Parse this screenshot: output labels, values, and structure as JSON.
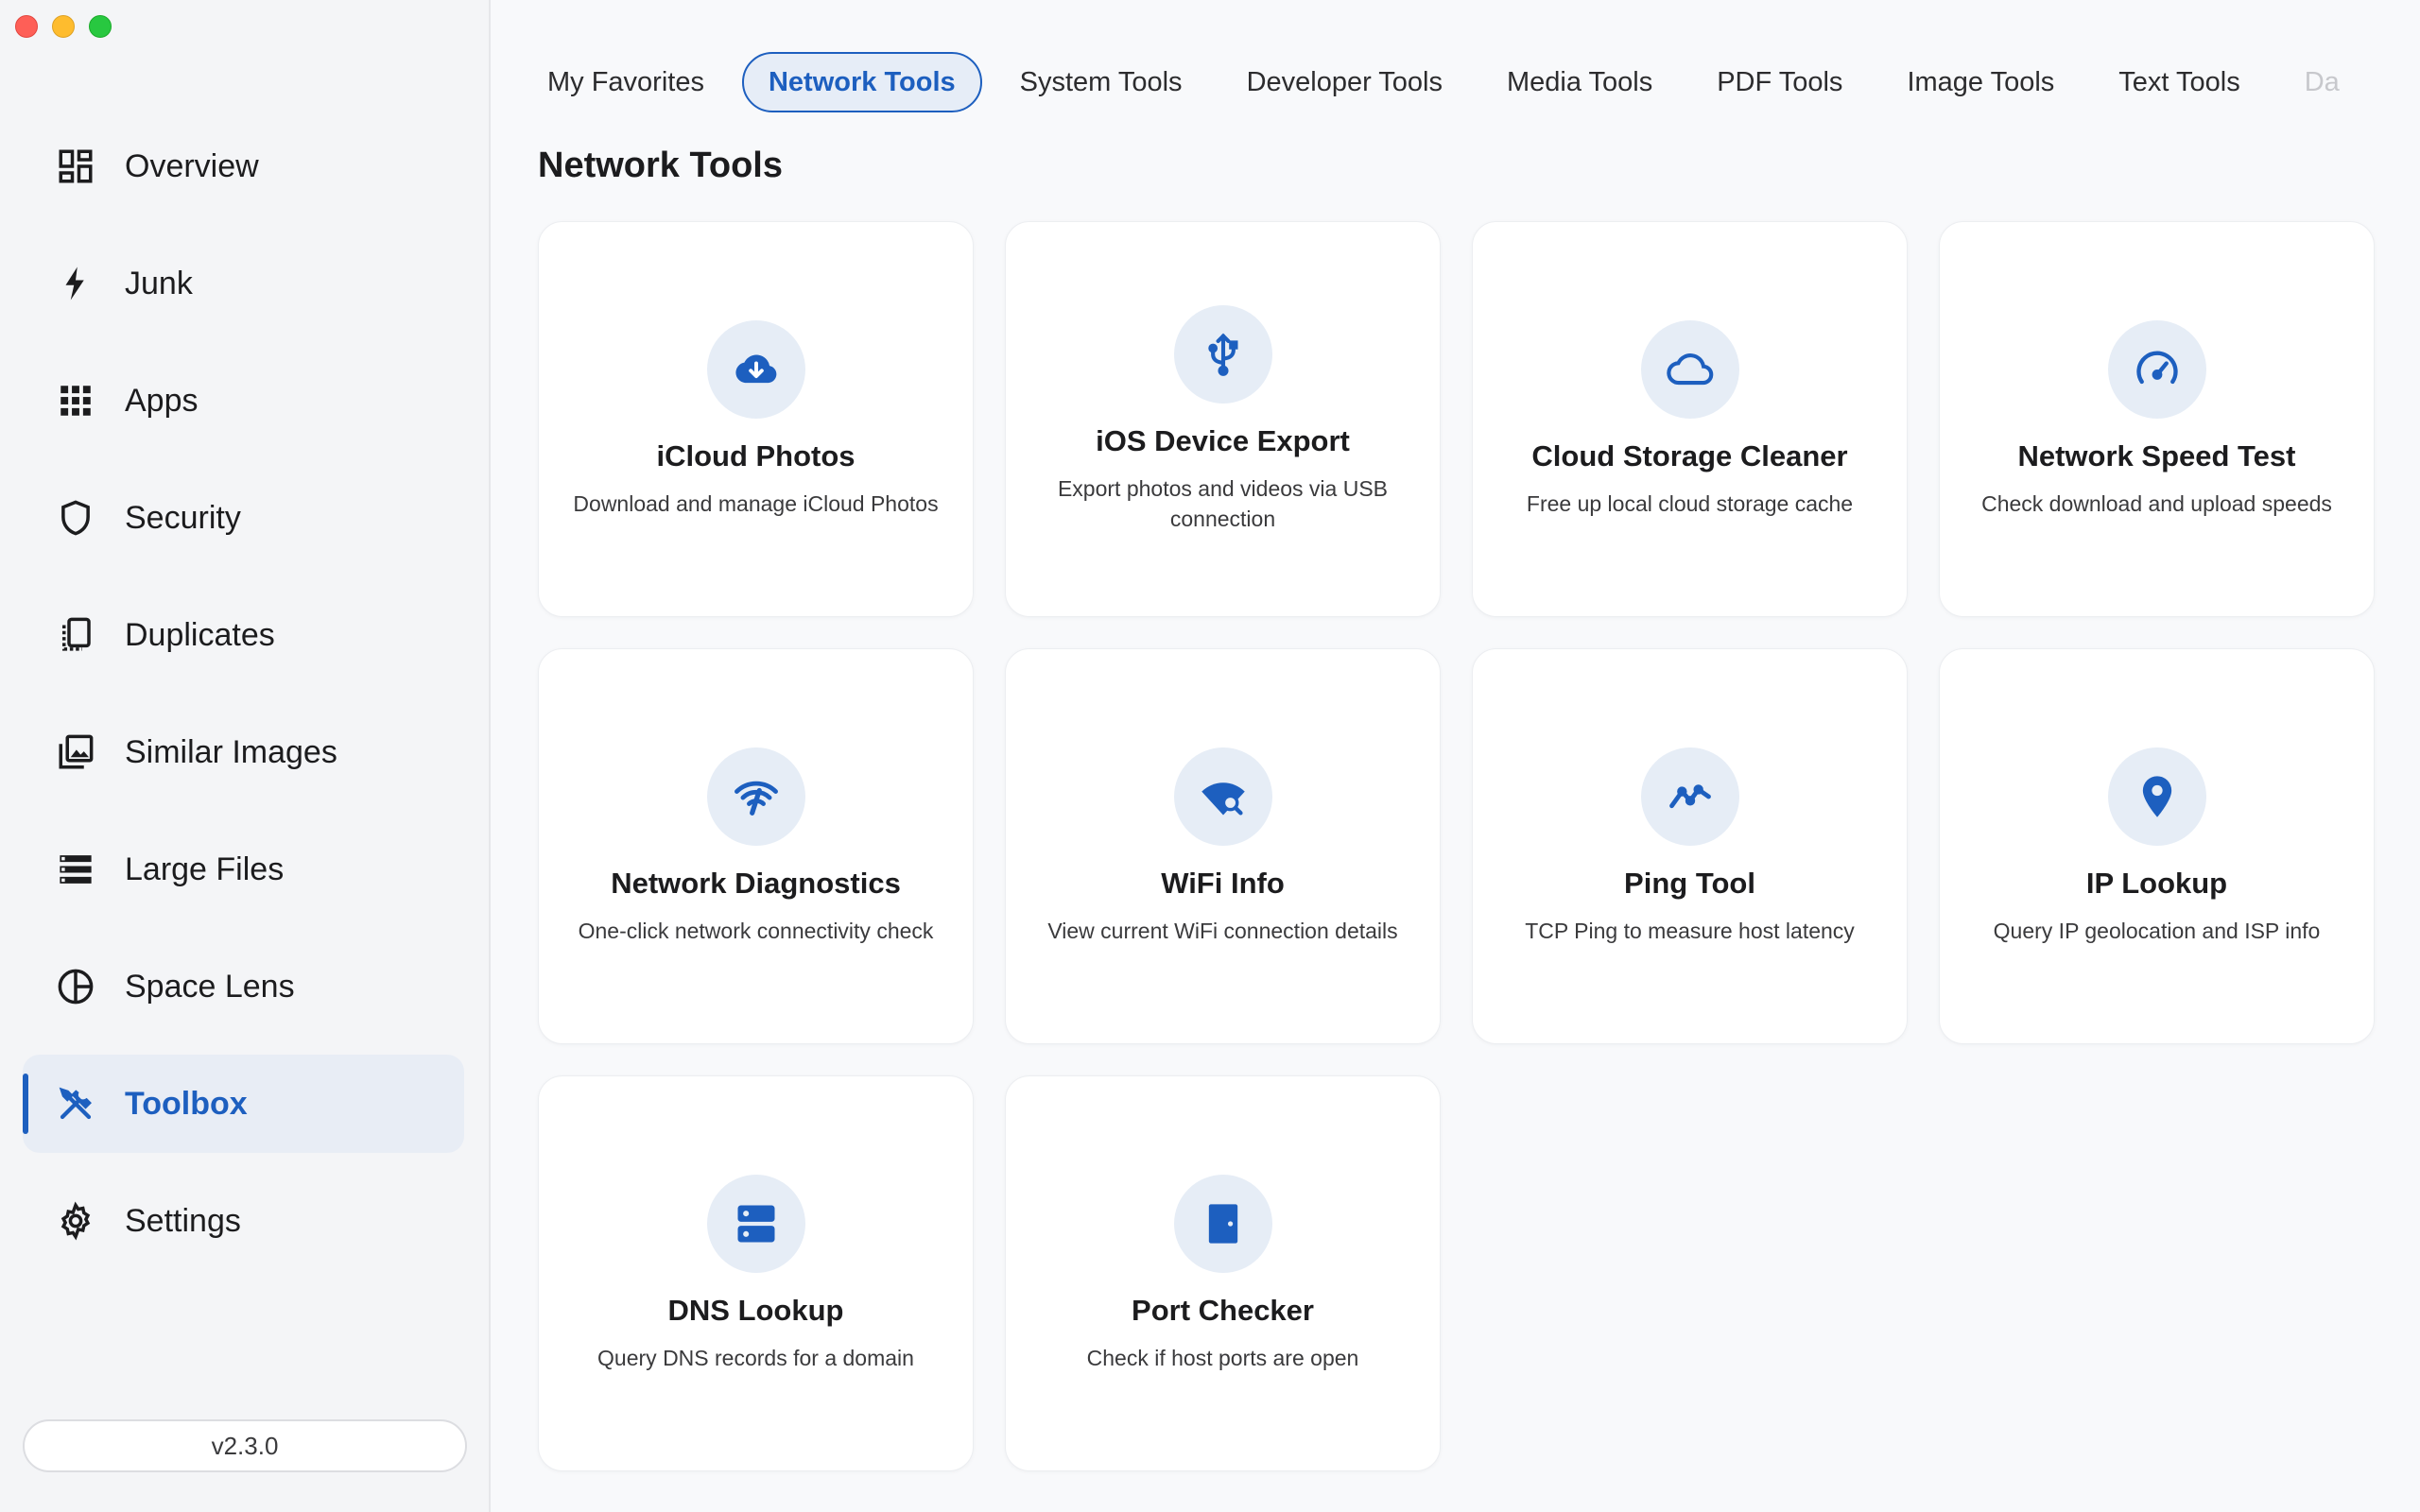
{
  "sidebar": {
    "items": [
      {
        "label": "Overview",
        "icon": "overview-icon"
      },
      {
        "label": "Junk",
        "icon": "bolt-icon"
      },
      {
        "label": "Apps",
        "icon": "apps-grid-icon"
      },
      {
        "label": "Security",
        "icon": "shield-icon"
      },
      {
        "label": "Duplicates",
        "icon": "duplicates-icon"
      },
      {
        "label": "Similar Images",
        "icon": "images-icon"
      },
      {
        "label": "Large Files",
        "icon": "large-files-icon"
      },
      {
        "label": "Space Lens",
        "icon": "pie-chart-icon"
      },
      {
        "label": "Toolbox",
        "icon": "tools-icon",
        "active": true
      },
      {
        "label": "Settings",
        "icon": "gear-icon"
      }
    ],
    "version": "v2.3.0"
  },
  "tabs": [
    {
      "label": "My Favorites"
    },
    {
      "label": "Network Tools",
      "active": true
    },
    {
      "label": "System Tools"
    },
    {
      "label": "Developer Tools"
    },
    {
      "label": "Media Tools"
    },
    {
      "label": "PDF Tools"
    },
    {
      "label": "Image Tools"
    },
    {
      "label": "Text Tools"
    },
    {
      "label": "Da",
      "faded": true
    }
  ],
  "section": {
    "title": "Network Tools"
  },
  "cards": [
    {
      "title": "iCloud Photos",
      "desc": "Download and manage iCloud Photos",
      "icon": "cloud-download-icon"
    },
    {
      "title": "iOS Device Export",
      "desc": "Export photos and videos via USB connection",
      "icon": "usb-icon"
    },
    {
      "title": "Cloud Storage Cleaner",
      "desc": "Free up local cloud storage cache",
      "icon": "cloud-icon"
    },
    {
      "title": "Network Speed Test",
      "desc": "Check download and upload speeds",
      "icon": "speedometer-icon"
    },
    {
      "title": "Network Diagnostics",
      "desc": "One-click network connectivity check",
      "icon": "wifi-tethering-icon"
    },
    {
      "title": "WiFi Info",
      "desc": "View current WiFi connection details",
      "icon": "wifi-search-icon"
    },
    {
      "title": "Ping Tool",
      "desc": "TCP Ping to measure host latency",
      "icon": "line-chart-icon"
    },
    {
      "title": "IP Lookup",
      "desc": "Query IP geolocation and ISP info",
      "icon": "location-pin-icon"
    },
    {
      "title": "DNS Lookup",
      "desc": "Query DNS records for a domain",
      "icon": "dns-icon"
    },
    {
      "title": "Port Checker",
      "desc": "Check if host ports are open",
      "icon": "door-icon"
    }
  ],
  "colors": {
    "accent": "#1d5fbf"
  }
}
